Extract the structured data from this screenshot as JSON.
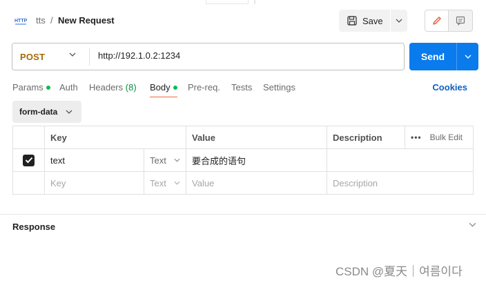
{
  "header": {
    "collection": "tts",
    "separator": "/",
    "request_title": "New Request",
    "save_label": "Save"
  },
  "request": {
    "method": "POST",
    "url": "http://192.1.0.2:1234",
    "send_label": "Send"
  },
  "tabs": [
    {
      "label": "Params",
      "dot": true
    },
    {
      "label": "Auth"
    },
    {
      "label": "Headers",
      "count": "(8)"
    },
    {
      "label": "Body",
      "dot": true,
      "active": true
    },
    {
      "label": "Pre-req."
    },
    {
      "label": "Tests"
    },
    {
      "label": "Settings"
    }
  ],
  "cookies_label": "Cookies",
  "body_type": "form-data",
  "table": {
    "headers": {
      "key": "Key",
      "value": "Value",
      "description": "Description",
      "bulk_edit": "Bulk Edit",
      "more": "•••"
    },
    "rows": [
      {
        "checked": true,
        "key": "text",
        "type": "Text",
        "value": "要合成的语句",
        "description": ""
      }
    ],
    "placeholder": {
      "key": "Key",
      "type": "Text",
      "value": "Value",
      "description": "Description"
    }
  },
  "response_label": "Response",
  "watermark": "CSDN @夏天｜여름이다",
  "colors": {
    "accent": "#f26b3a",
    "send": "#097bed",
    "method": "#a56b00",
    "status_dot": "#0cbb52",
    "link": "#0b5fc4"
  }
}
